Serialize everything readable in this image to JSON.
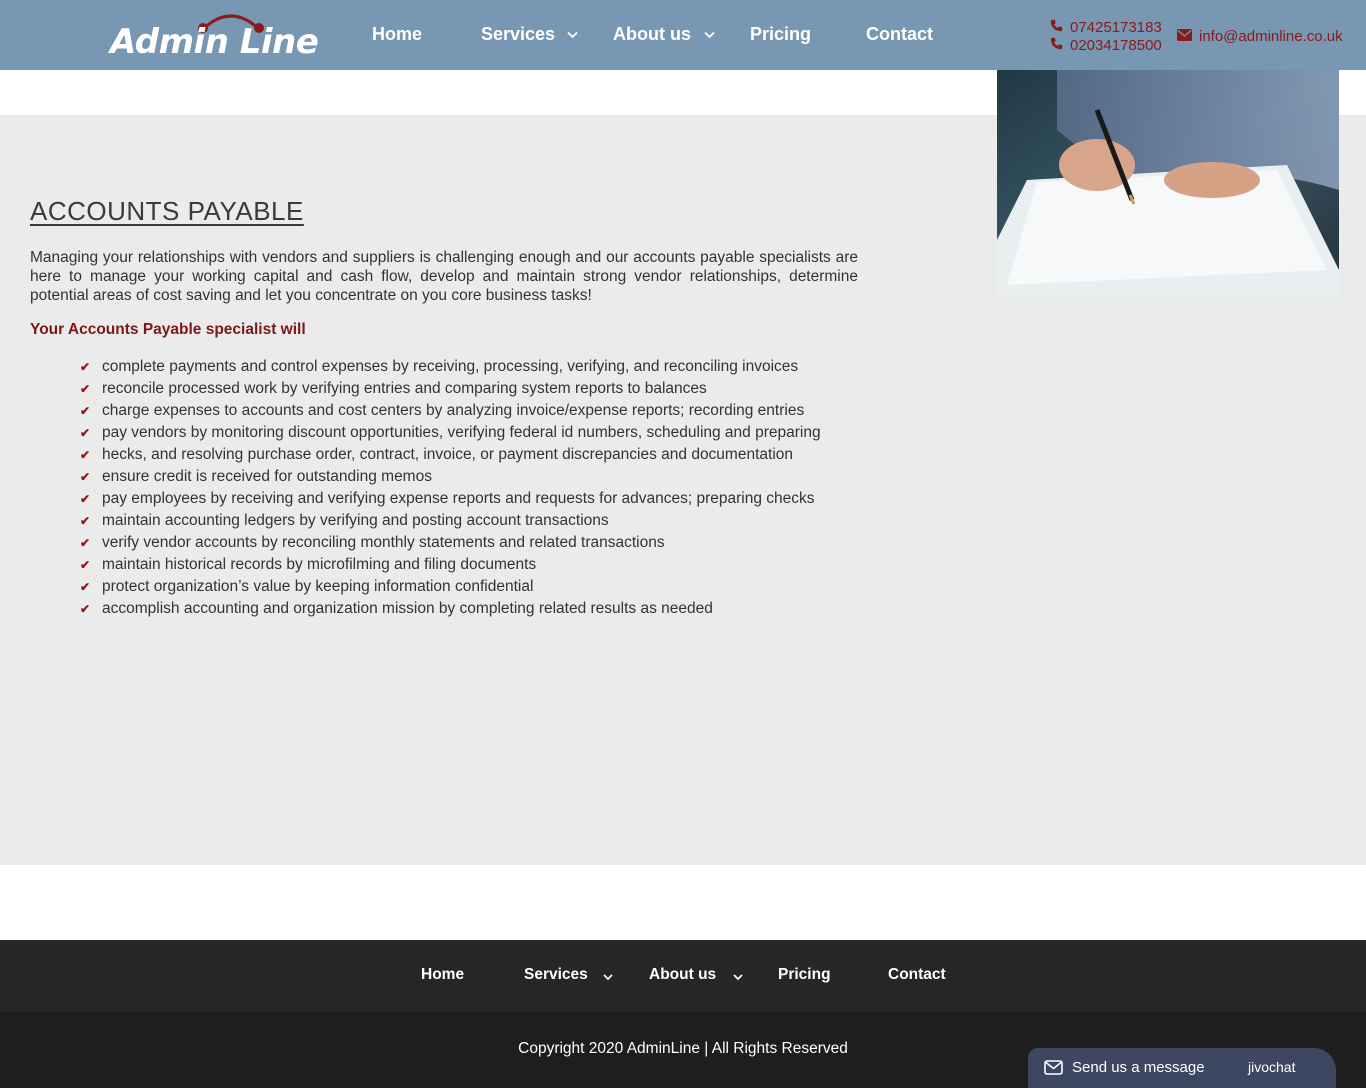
{
  "brand": {
    "logo_text": "Admin Line",
    "accent_color": "#8b1a1a",
    "header_color": "#7797b2"
  },
  "header": {
    "nav": [
      {
        "label": "Home"
      },
      {
        "label": "Services"
      },
      {
        "label": "About us"
      },
      {
        "label": "Pricing"
      },
      {
        "label": "Contact"
      }
    ],
    "phones": [
      "07425173183",
      "02034178500"
    ],
    "email": "info@adminline.co.uk",
    "icons": {
      "phone": "phone-icon",
      "email": "envelope-icon",
      "dropdown": "chevron-down-icon"
    }
  },
  "main": {
    "title": "ACCOUNTS PAYABLE",
    "intro": "Managing your relationships with vendors and suppliers is challenging enough and our accounts payable specialists are here to manage your working capital and cash flow, develop and maintain strong vendor relationships, determine potential areas of cost saving and let you concentrate on you core business tasks!",
    "subhead": "Your Accounts Payable specialist will",
    "duties": [
      "complete payments and control expenses by receiving, processing, verifying, and reconciling invoices",
      "reconcile processed work by verifying entries and comparing system reports to balances",
      "charge expenses to accounts and cost centers by analyzing invoice/expense reports; recording entries",
      "pay vendors by monitoring discount opportunities, verifying federal id numbers, scheduling and preparing",
      "hecks, and resolving purchase order, contract, invoice, or payment discrepancies and documentation",
      "ensure credit is received for outstanding memos",
      "pay employees by receiving and verifying expense reports and requests for advances; preparing checks",
      "maintain accounting ledgers by verifying and posting account transactions",
      "verify vendor accounts by reconciling monthly statements and related transactions",
      "maintain historical records by microfilming and filing documents",
      "protect organization’s value by keeping information confidential",
      "accomplish accounting and organization mission by completing related results as needed"
    ]
  },
  "footer": {
    "nav": [
      {
        "label": "Home"
      },
      {
        "label": "Services"
      },
      {
        "label": "About us"
      },
      {
        "label": "Pricing"
      },
      {
        "label": "Contact"
      }
    ],
    "copyright": "Copyright 2020 AdminLine | All Rights Reserved"
  },
  "chat_widget": {
    "label": "Send us a message",
    "brand": "jivochat"
  }
}
